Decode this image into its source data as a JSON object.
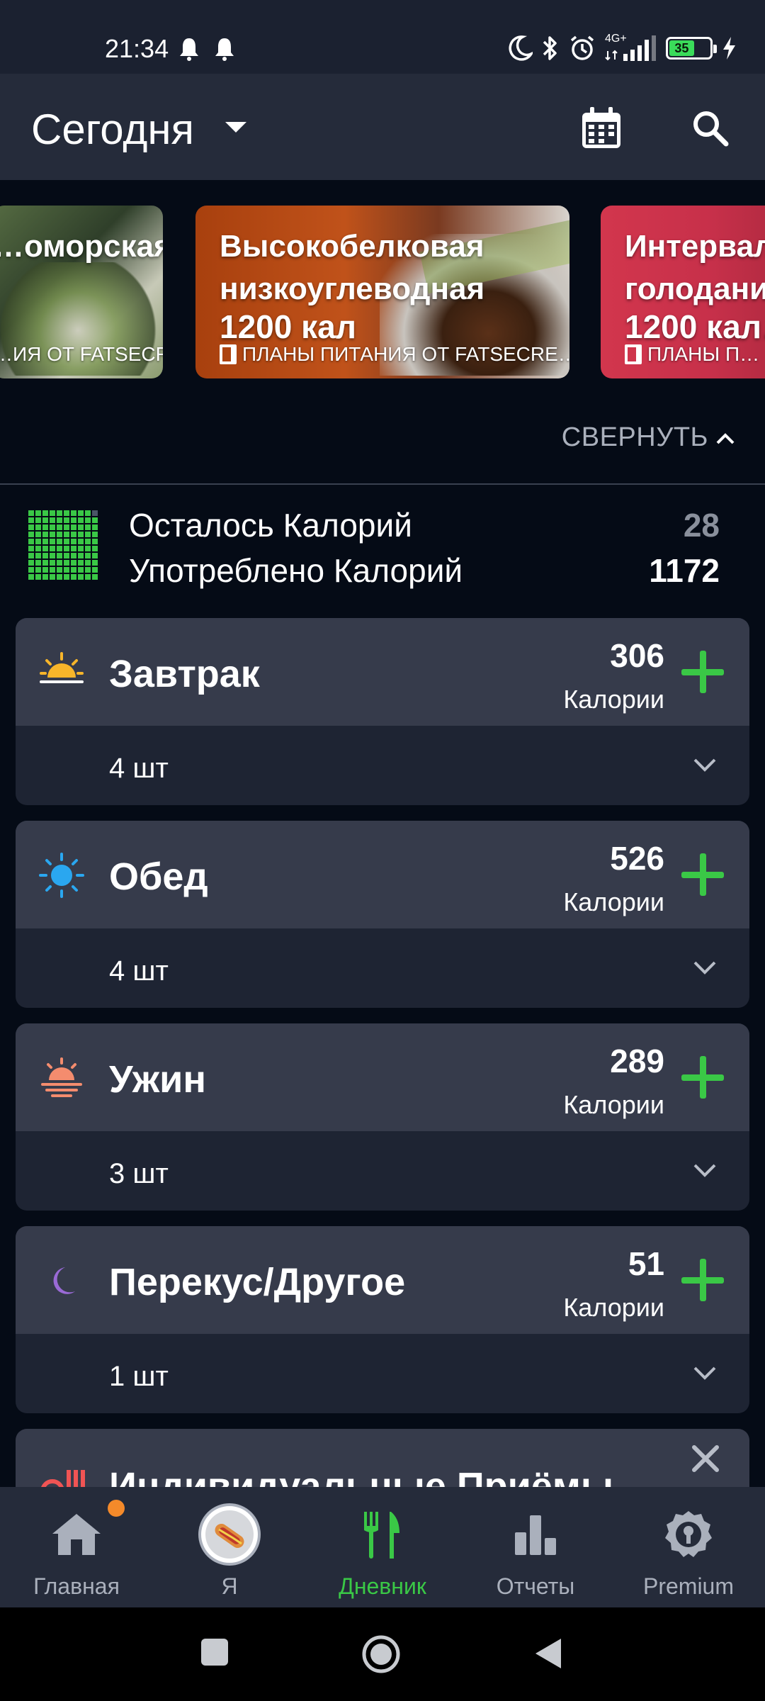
{
  "status_bar": {
    "time": "21:34",
    "network": "4G+",
    "battery": "35"
  },
  "header": {
    "title": "Сегодня",
    "calendar_icon": "calendar-icon",
    "search_icon": "search-icon"
  },
  "meal_plans": [
    {
      "title": "…оморская",
      "kcal": "",
      "subtitle": "…ИЯ ОТ FATSECRE…",
      "color": "#4f6b4a"
    },
    {
      "title_line1": "Высокобелковая",
      "title_line2": "низкоуглеводная",
      "kcal": "1200 кал",
      "subtitle": "ПЛАНЫ ПИТАНИЯ ОТ FATSECRE…",
      "color": "#b84a14"
    },
    {
      "title_line1": "Интервал…",
      "title_line2": "голодани…",
      "kcal": "1200 кал…",
      "subtitle": "ПЛАНЫ П…",
      "color": "#d63a50"
    }
  ],
  "collapse_label": "СВЕРНУТЬ",
  "summary": {
    "remaining_label": "Осталось Калорий",
    "remaining_value": "28",
    "consumed_label": "Употреблено Калорий",
    "consumed_value": "1172"
  },
  "meals": [
    {
      "name": "Завтрак",
      "calories": "306",
      "calories_label": "Калории",
      "count": "4 шт",
      "icon": "sunrise-icon"
    },
    {
      "name": "Обед",
      "calories": "526",
      "calories_label": "Калории",
      "count": "4 шт",
      "icon": "sun-icon"
    },
    {
      "name": "Ужин",
      "calories": "289",
      "calories_label": "Калории",
      "count": "3 шт",
      "icon": "sunset-icon"
    },
    {
      "name": "Перекус/Другое",
      "calories": "51",
      "calories_label": "Калории",
      "count": "1 шт",
      "icon": "moon-icon"
    }
  ],
  "custom_meals_title": "Индивидуальные Приёмы",
  "bottom_nav": [
    {
      "label": "Главная",
      "icon": "home-icon",
      "active": false
    },
    {
      "label": "Я",
      "icon": "avatar-icon",
      "active": false
    },
    {
      "label": "Дневник",
      "icon": "fork-knife-icon",
      "active": true
    },
    {
      "label": "Отчеты",
      "icon": "bar-chart-icon",
      "active": false
    },
    {
      "label": "Premium",
      "icon": "premium-badge-icon",
      "active": false
    }
  ],
  "colors": {
    "accent_green": "#3ac846",
    "header_bg": "#252b3a",
    "card_bg": "#363b4b",
    "page_bg": "#050b16",
    "notification_dot": "#f48a2a"
  }
}
